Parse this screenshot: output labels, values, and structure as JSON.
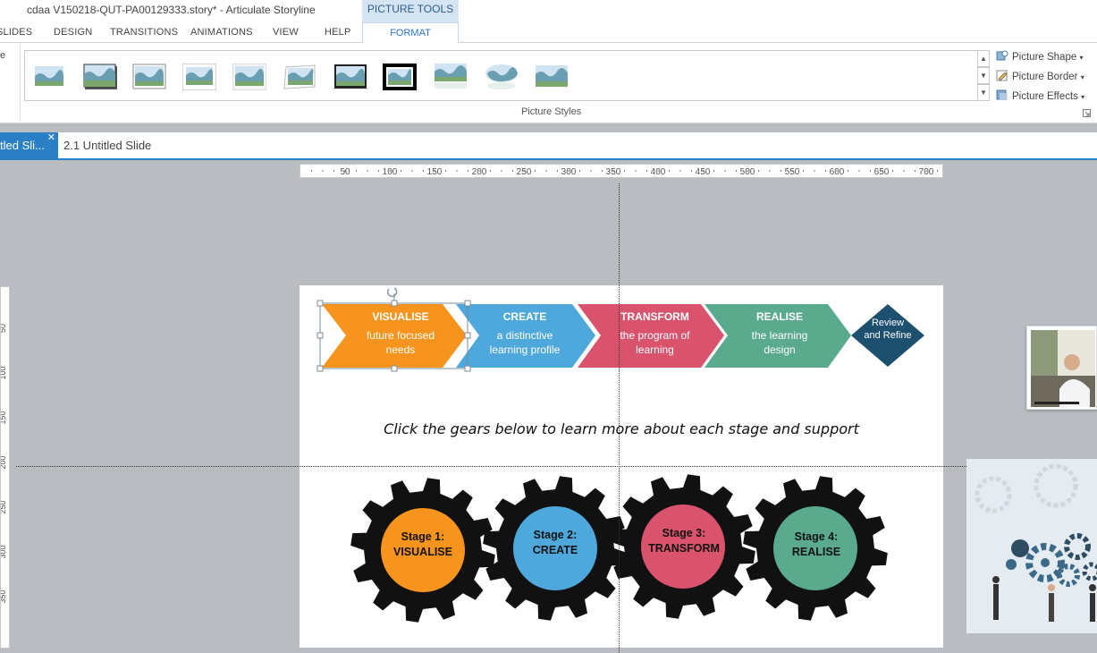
{
  "titlebar": {
    "title": "cdaa V150218-QUT-PA00129333.story* -  Articulate Storyline",
    "context_group": "PICTURE TOOLS"
  },
  "tabs": [
    {
      "label": "SLIDES"
    },
    {
      "label": "DESIGN"
    },
    {
      "label": "TRANSITIONS"
    },
    {
      "label": "ANIMATIONS"
    },
    {
      "label": "VIEW"
    },
    {
      "label": "HELP"
    }
  ],
  "active_tab": {
    "label": "FORMAT"
  },
  "ribbon": {
    "group_label": "Picture Styles",
    "picture_shape": "Picture Shape",
    "picture_border": "Picture Border",
    "picture_effects": "Picture Effects",
    "left_cut_label": "e"
  },
  "doc_tabs": {
    "active": "tled Sli...",
    "other": "2.1 Untitled Slide"
  },
  "ruler": {
    "h_ticks": [
      "50",
      "100",
      "150",
      "200",
      "250",
      "300",
      "350",
      "400",
      "450",
      "500",
      "550",
      "600",
      "650",
      "700"
    ],
    "v_ticks": [
      "50",
      "100",
      "150",
      "200",
      "250",
      "300",
      "350"
    ]
  },
  "slide": {
    "stages": [
      {
        "title": "VISUALISE",
        "desc": "future focused needs",
        "color": "#f7941d"
      },
      {
        "title": "CREATE",
        "desc": "a distinctive learning profile",
        "color": "#4ea8dc"
      },
      {
        "title": "TRANSFORM",
        "desc": "the program of learning",
        "color": "#d9536c"
      },
      {
        "title": "REALISE",
        "desc": "the learning design",
        "color": "#5aaa8e"
      }
    ],
    "review": {
      "label": "Review and Refine",
      "color": "#1d4f6e"
    },
    "instruction": "Click the gears below to learn more about each stage and support",
    "gears": [
      {
        "line1": "Stage 1:",
        "line2": "VISUALISE",
        "color": "#f7941d"
      },
      {
        "line1": "Stage 2:",
        "line2": "CREATE",
        "color": "#4ea8dc"
      },
      {
        "line1": "Stage 3:",
        "line2": "TRANSFORM",
        "color": "#d9536c"
      },
      {
        "line1": "Stage 4:",
        "line2": "REALISE",
        "color": "#5aaa8e"
      }
    ]
  }
}
